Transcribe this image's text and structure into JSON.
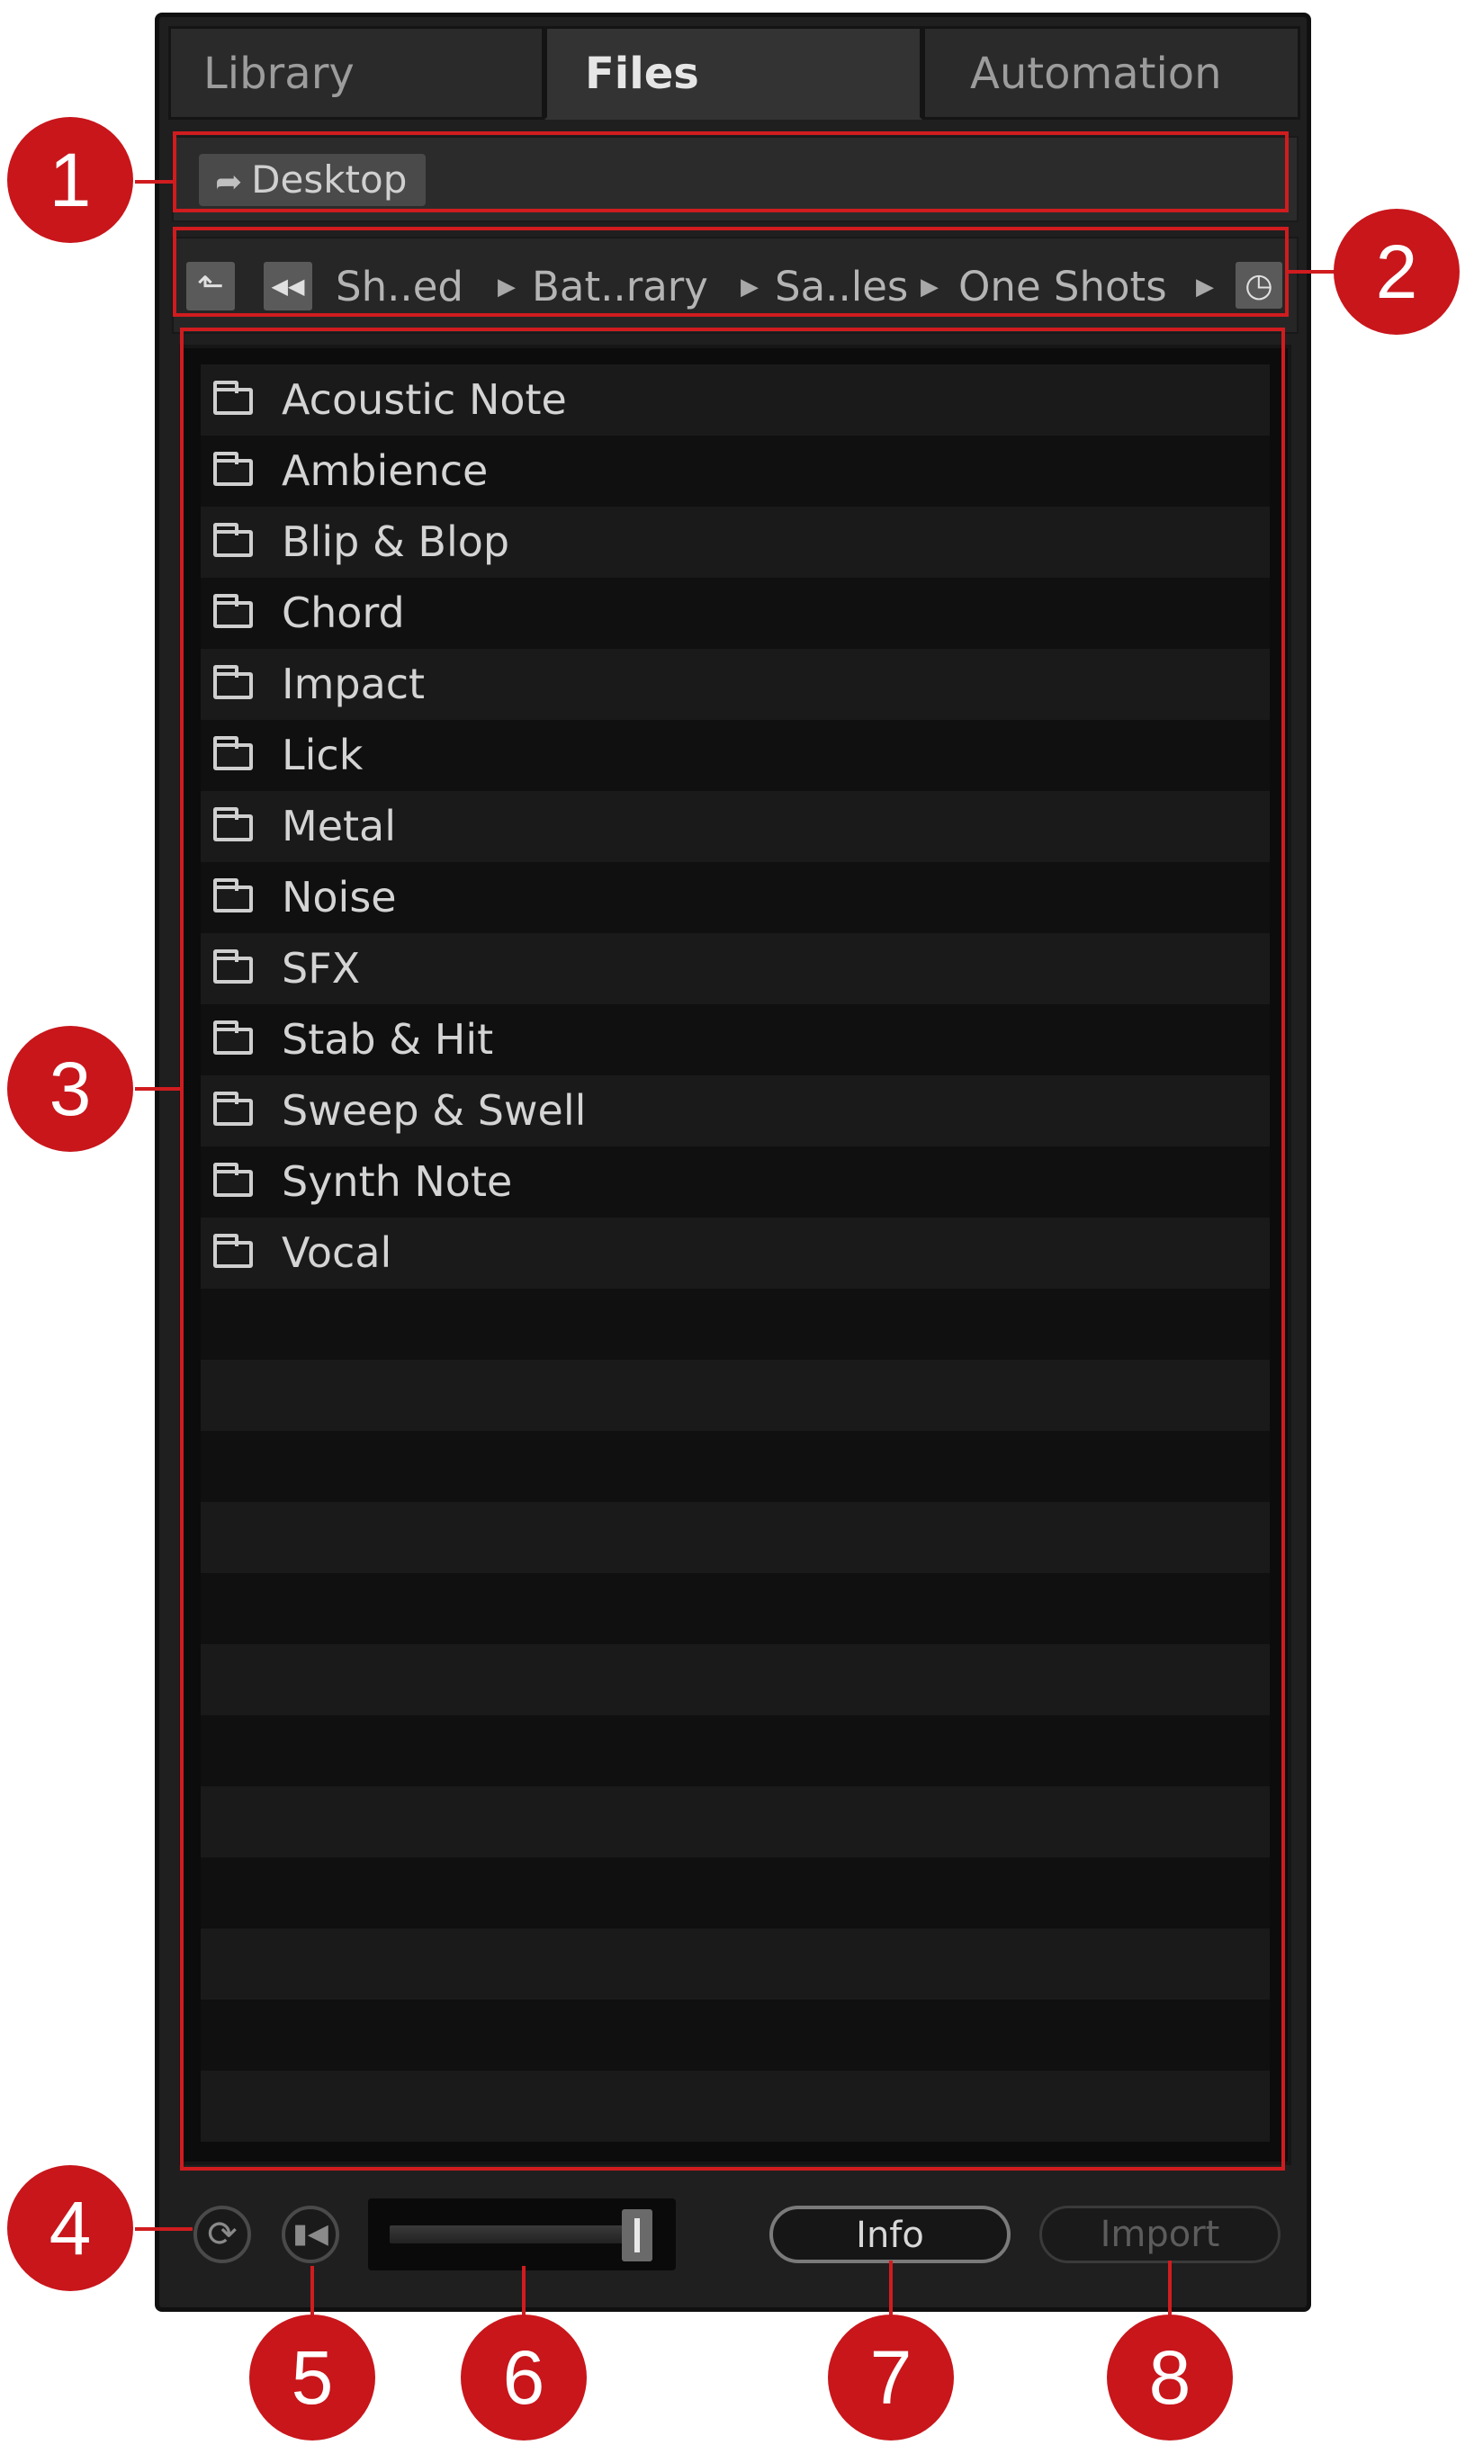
{
  "tabs": [
    "Library",
    "Files",
    "Automation"
  ],
  "favorites": {
    "button_label": "Desktop"
  },
  "path": {
    "crumbs": [
      "Sh..ed",
      "Bat..rary",
      "Sa..les",
      "One Shots"
    ]
  },
  "file_list": {
    "items": [
      "Acoustic Note",
      "Ambience",
      "Blip & Blop",
      "Chord",
      "Impact",
      "Lick",
      "Metal",
      "Noise",
      "SFX",
      "Stab & Hit",
      "Sweep & Swell",
      "Synth Note",
      "Vocal"
    ]
  },
  "controls": {
    "info_label": "Info",
    "import_label": "Import"
  },
  "callouts": [
    "1",
    "2",
    "3",
    "4",
    "5",
    "6",
    "7",
    "8"
  ],
  "colors": {
    "callout": "#c8161b",
    "panel": "#1f1f1f"
  }
}
